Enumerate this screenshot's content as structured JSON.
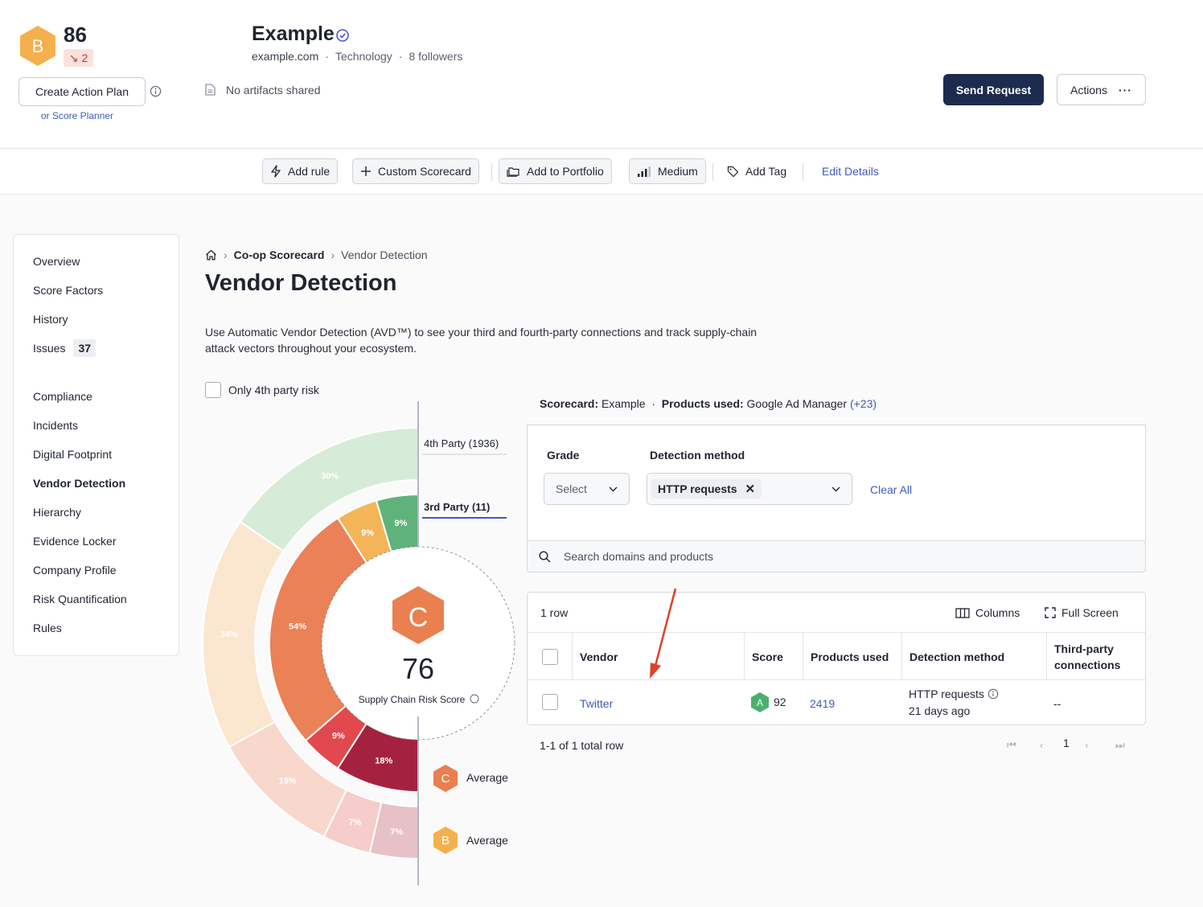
{
  "company": {
    "grade": "B",
    "score": "86",
    "score_delta": "2",
    "name": "Example",
    "domain": "example.com",
    "industry": "Technology",
    "followers": "8 followers",
    "artifacts": "No artifacts shared",
    "create_action_plan": "Create Action Plan",
    "score_planner": "or Score Planner",
    "send_request": "Send Request",
    "actions": "Actions",
    "colors": {
      "grade_b": "#f4b04c",
      "grade_c": "#ea7f4f",
      "grade_a": "#4caf6e",
      "primary": "#1d2b4f",
      "link": "#3f5bb8"
    }
  },
  "toolbar": {
    "add_rule": "Add rule",
    "custom_scorecard": "Custom Scorecard",
    "add_portfolio": "Add to Portfolio",
    "medium": "Medium",
    "add_tag": "Add Tag",
    "edit_details": "Edit Details"
  },
  "sidebar": {
    "items": [
      {
        "label": "Overview"
      },
      {
        "label": "Score Factors"
      },
      {
        "label": "History"
      },
      {
        "label": "Issues",
        "badge": "37"
      },
      {
        "label": "Compliance"
      },
      {
        "label": "Incidents"
      },
      {
        "label": "Digital Footprint"
      },
      {
        "label": "Vendor Detection",
        "active": true
      },
      {
        "label": "Hierarchy"
      },
      {
        "label": "Evidence Locker"
      },
      {
        "label": "Company Profile"
      },
      {
        "label": "Risk Quantification"
      },
      {
        "label": "Rules"
      }
    ]
  },
  "breadcrumb": {
    "parent": "Co-op Scorecard",
    "current": "Vendor Detection"
  },
  "page": {
    "title": "Vendor Detection",
    "description": "Use Automatic Vendor Detection (AVD™) to see your third and fourth-party connections and track supply-chain attack vectors throughout your ecosystem.",
    "only_4th_party": "Only 4th party risk"
  },
  "chart": {
    "center_grade": "C",
    "center_score": "76",
    "center_label": "Supply Chain Risk Score",
    "fourth_party_label": "4th Party (1936)",
    "third_party_label": "3rd Party (11)",
    "legend": [
      {
        "grade": "C",
        "label": "Average"
      },
      {
        "grade": "B",
        "label": "Average"
      }
    ],
    "outer_ring": [
      {
        "pct": 30,
        "label": "30%",
        "color": "#d6ecd8"
      },
      {
        "pct": 34,
        "label": "34%",
        "color": "#fbe6cf"
      },
      {
        "pct": 19,
        "label": "19%",
        "color": "#f8d8cd"
      },
      {
        "pct": 7,
        "label": "7%",
        "color": "#f6cdca"
      },
      {
        "pct": 7,
        "label": "7%",
        "color": "#e8c1c8"
      }
    ],
    "inner_ring": [
      {
        "pct": 9,
        "label": "9%",
        "color": "#5fb37a"
      },
      {
        "pct": 9,
        "label": "9%",
        "color": "#f4b558"
      },
      {
        "pct": 54,
        "label": "54%",
        "color": "#ea8157"
      },
      {
        "pct": 9,
        "label": "9%",
        "color": "#e2494f"
      },
      {
        "pct": 18,
        "label": "18%",
        "color": "#a4223f"
      }
    ]
  },
  "filters": {
    "scorecard_label": "Scorecard:",
    "scorecard_value": "Example",
    "products_label": "Products used:",
    "products_value": "Google Ad Manager",
    "products_more": "(+23)",
    "grade_label": "Grade",
    "grade_placeholder": "Select",
    "method_label": "Detection method",
    "method_chip": "HTTP requests",
    "clear_all": "Clear All",
    "search_placeholder": "Search domains and products"
  },
  "table": {
    "row_count": "1 row",
    "columns_btn": "Columns",
    "fullscreen_btn": "Full Screen",
    "headers": [
      "Vendor",
      "Score",
      "Products used",
      "Detection method",
      "Third-party connections"
    ],
    "rows": [
      {
        "vendor": "Twitter",
        "grade": "A",
        "score": "92",
        "products": "2419",
        "method": "HTTP requests",
        "method_time": "21 days ago",
        "connections": "--"
      }
    ],
    "pager_text": "1-1 of 1 total row",
    "page": "1"
  }
}
